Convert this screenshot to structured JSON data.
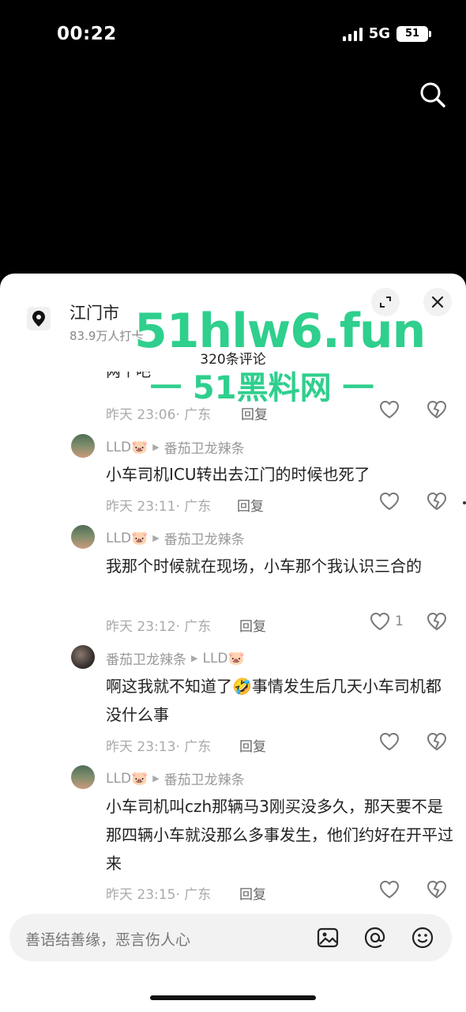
{
  "status": {
    "time": "00:22",
    "network": "5G",
    "battery": "51"
  },
  "location": {
    "city": "江门市",
    "checkins": "83.9万人打卡"
  },
  "comment_count": "320条评论",
  "partial_comment": {
    "text": "两个吧",
    "time": "昨天 23:06",
    "region": "· 广东",
    "reply": "回复"
  },
  "comments": [
    {
      "user": "LLD🐷",
      "reply_to": "番茄卫龙辣条",
      "text": "小车司机ICU转出去江门的时候也死了",
      "time": "昨天 23:11",
      "region": "· 广东",
      "reply": "回复",
      "likes": ""
    },
    {
      "user": "LLD🐷",
      "reply_to": "番茄卫龙辣条",
      "text": "我那个时候就在现场，小车那个我认识三合的",
      "time": "昨天 23:12",
      "region": "· 广东",
      "reply": "回复",
      "likes": "1"
    },
    {
      "user": "番茄卫龙辣条",
      "reply_to": "LLD🐷",
      "text": "啊这我就不知道了🤣事情发生后几天小车司机都没什么事",
      "time": "昨天 23:13",
      "region": "· 广东",
      "reply": "回复",
      "likes": ""
    },
    {
      "user": "LLD🐷",
      "reply_to": "番茄卫龙辣条",
      "text": "小车司机叫czh那辆马3刚买没多久，那天要不是那四辆小车就没那么多事发生，他们约好在开平过来",
      "time": "昨天 23:15",
      "region": "· 广东",
      "reply": "回复",
      "likes": ""
    }
  ],
  "input": {
    "placeholder": "善语结善缘，恶言伤人心"
  },
  "watermark": {
    "line1": "51hlw6.fun",
    "line2": "一 51黑料网 一"
  },
  "icons": [
    "search-icon",
    "location-pin-icon",
    "expand-icon",
    "close-icon",
    "heart-icon",
    "broken-heart-icon",
    "image-icon",
    "at-icon",
    "emoji-icon"
  ]
}
